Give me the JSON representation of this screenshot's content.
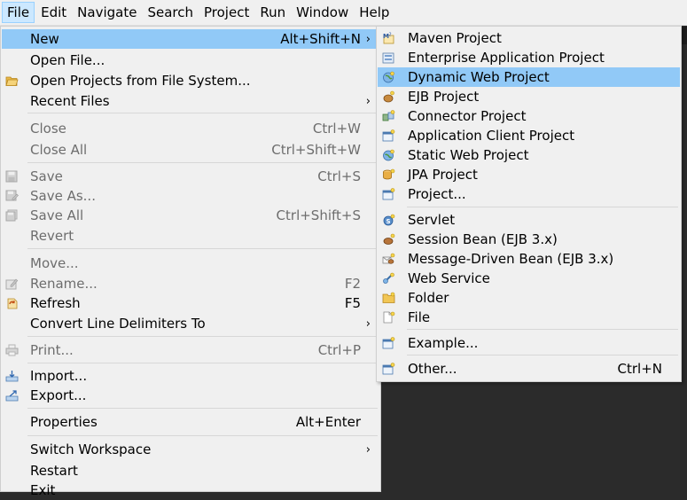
{
  "menubar": {
    "items": [
      "File",
      "Edit",
      "Navigate",
      "Search",
      "Project",
      "Run",
      "Window",
      "Help"
    ]
  },
  "file_menu": {
    "new": {
      "label": "New",
      "accel": "Alt+Shift+N"
    },
    "open_file": {
      "label": "Open File..."
    },
    "open_projects": {
      "label": "Open Projects from File System..."
    },
    "recent_files": {
      "label": "Recent Files"
    },
    "close": {
      "label": "Close",
      "accel": "Ctrl+W"
    },
    "close_all": {
      "label": "Close All",
      "accel": "Ctrl+Shift+W"
    },
    "save": {
      "label": "Save",
      "accel": "Ctrl+S"
    },
    "save_as": {
      "label": "Save As..."
    },
    "save_all": {
      "label": "Save All",
      "accel": "Ctrl+Shift+S"
    },
    "revert": {
      "label": "Revert"
    },
    "move": {
      "label": "Move..."
    },
    "rename": {
      "label": "Rename...",
      "accel": "F2"
    },
    "refresh": {
      "label": "Refresh",
      "accel": "F5"
    },
    "convert": {
      "label": "Convert Line Delimiters To"
    },
    "print": {
      "label": "Print...",
      "accel": "Ctrl+P"
    },
    "import": {
      "label": "Import..."
    },
    "export": {
      "label": "Export..."
    },
    "properties": {
      "label": "Properties",
      "accel": "Alt+Enter"
    },
    "switch_workspace": {
      "label": "Switch Workspace"
    },
    "restart": {
      "label": "Restart"
    },
    "exit": {
      "label": "Exit"
    }
  },
  "new_menu": {
    "maven": {
      "label": "Maven Project"
    },
    "enterprise": {
      "label": "Enterprise Application Project"
    },
    "dynamic_web": {
      "label": "Dynamic Web Project"
    },
    "ejb": {
      "label": "EJB Project"
    },
    "connector": {
      "label": "Connector Project"
    },
    "app_client": {
      "label": "Application Client Project"
    },
    "static_web": {
      "label": "Static Web Project"
    },
    "jpa": {
      "label": "JPA Project"
    },
    "project": {
      "label": "Project..."
    },
    "servlet": {
      "label": "Servlet"
    },
    "session_bean": {
      "label": "Session Bean (EJB 3.x)"
    },
    "mdb": {
      "label": "Message-Driven Bean (EJB 3.x)"
    },
    "web_service": {
      "label": "Web Service"
    },
    "folder": {
      "label": "Folder"
    },
    "file": {
      "label": "File"
    },
    "example": {
      "label": "Example..."
    },
    "other": {
      "label": "Other...",
      "accel": "Ctrl+N"
    }
  },
  "submenu_arrow": "›",
  "colors": {
    "menu_bg": "#f0f0f0",
    "highlight": "#91c9f7",
    "menubar_active": "#cce8ff",
    "disabled_text": "#6d6d6d",
    "editor_bg": "#2b2b2b"
  }
}
